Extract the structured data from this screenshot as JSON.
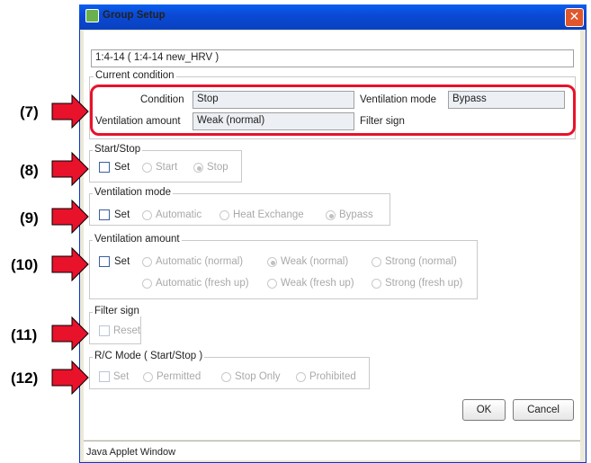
{
  "window": {
    "title": "Group Setup",
    "close": "✕"
  },
  "group_id": "1:4-14 ( 1:4-14 new_HRV )",
  "current_condition": {
    "legend": "Current condition",
    "condition_label": "Condition",
    "condition_value": "Stop",
    "vent_mode_label": "Ventilation mode",
    "vent_mode_value": "Bypass",
    "vent_amount_label": "Ventilation amount",
    "vent_amount_value": "Weak (normal)",
    "filter_sign_label": "Filter sign"
  },
  "start_stop": {
    "legend": "Start/Stop",
    "set": "Set",
    "options": [
      "Start",
      "Stop"
    ],
    "selected": "Stop"
  },
  "ventilation_mode": {
    "legend": "Ventilation mode",
    "set": "Set",
    "options": [
      "Automatic",
      "Heat Exchange",
      "Bypass"
    ],
    "selected": "Bypass"
  },
  "ventilation_amount": {
    "legend": "Ventilation amount",
    "set": "Set",
    "options_row1": [
      "Automatic (normal)",
      "Weak (normal)",
      "Strong (normal)"
    ],
    "options_row2": [
      "Automatic (fresh up)",
      "Weak (fresh up)",
      "Strong (fresh up)"
    ],
    "selected": "Weak (normal)"
  },
  "filter_sign": {
    "legend": "Filter sign",
    "reset": "Reset"
  },
  "rc_mode": {
    "legend": "R/C Mode ( Start/Stop )",
    "set": "Set",
    "options": [
      "Permitted",
      "Stop Only",
      "Prohibited"
    ]
  },
  "buttons": {
    "ok": "OK",
    "cancel": "Cancel"
  },
  "status_bar": "Java Applet Window",
  "callouts": [
    "(7)",
    "(8)",
    "(9)",
    "(10)",
    "(11)",
    "(12)"
  ],
  "colors": {
    "callout_red": "#e8122b",
    "titlebar_blue": "#0b4ad6"
  }
}
